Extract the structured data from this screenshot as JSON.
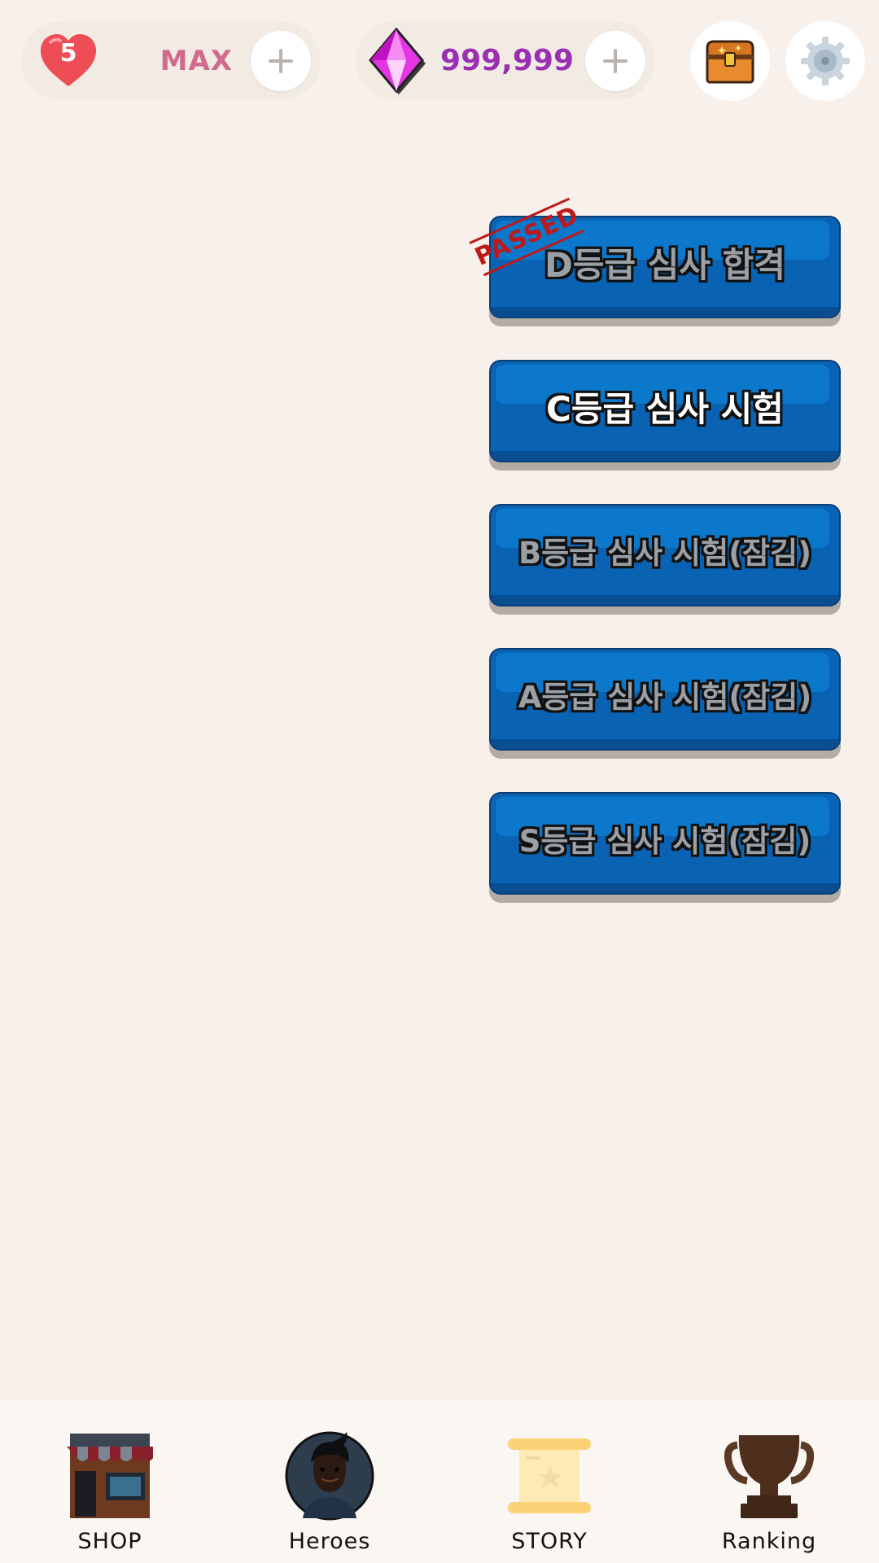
{
  "top_bar": {
    "hearts": {
      "count": "5",
      "status": "MAX",
      "icon": "heart-icon"
    },
    "gems": {
      "value": "999,999",
      "icon": "gem-icon"
    },
    "buttons": [
      "treasure-chest-icon",
      "gear-icon"
    ]
  },
  "exams": {
    "stamp": "PASSED",
    "items": [
      {
        "label": "D등급 심사 합격",
        "state": "passed"
      },
      {
        "label": "C등급 심사 시험",
        "state": "active"
      },
      {
        "label": "B등급 심사 시험(잠김)",
        "state": "locked"
      },
      {
        "label": "A등급 심사 시험(잠김)",
        "state": "locked"
      },
      {
        "label": "S등급 심사 시험(잠김)",
        "state": "locked"
      }
    ]
  },
  "bottom_nav": {
    "items": [
      {
        "label": "SHOP",
        "icon": "shop-icon"
      },
      {
        "label": "Heroes",
        "icon": "hero-avatar-icon"
      },
      {
        "label": "STORY",
        "icon": "scroll-icon"
      },
      {
        "label": "Ranking",
        "icon": "trophy-icon"
      }
    ]
  },
  "colors": {
    "background": "#f8f1eb",
    "button_face": "#0a63b2",
    "button_highlight": "#0b78cc",
    "stamp_red": "#c01818",
    "max_pink": "#d16a8c",
    "gem_purple": "#9b2fb3"
  }
}
